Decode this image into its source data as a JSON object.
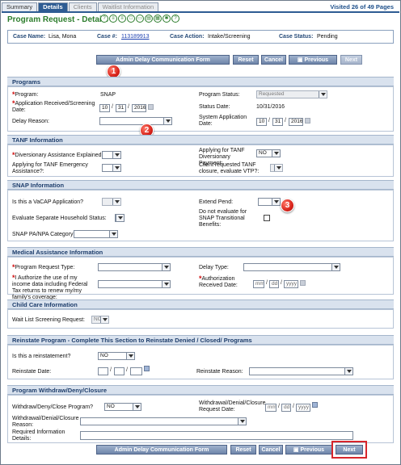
{
  "tabs": [
    {
      "label": "Summary"
    },
    {
      "label": "Details"
    },
    {
      "label": "Clients"
    },
    {
      "label": "Waitlist Information"
    }
  ],
  "visited": "Visited 26 of 49 Pages",
  "page_title": "Program Request - Details",
  "case": {
    "name_label": "Case Name:",
    "name_value": "Lisa, Mona",
    "num_label": "Case #:",
    "num_value": "113189913",
    "action_label": "Case Action:",
    "action_value": "Intake/Screening",
    "status_label": "Case Status:",
    "status_value": "Pending"
  },
  "buttons": {
    "admin_delay": "Admin Delay Communication Form",
    "reset": "Reset",
    "cancel": "Cancel",
    "previous": "Previous",
    "next": "Next"
  },
  "callouts": [
    "1",
    "2",
    "3"
  ],
  "programs": {
    "header": "Programs",
    "program_label": "Program:",
    "program_value": "SNAP",
    "status_label": "Program Status:",
    "status_value": "Requested",
    "app_date_label": "Application Received/Screening Date:",
    "app_month": "10",
    "app_day": "31",
    "app_year": "2016",
    "status_date_label": "Status Date:",
    "status_date_value": "10/31/2016",
    "delay_label": "Delay Reason:",
    "sys_date_label": "System Application Date:",
    "sys_month": "10",
    "sys_day": "31",
    "sys_year": "2016"
  },
  "tanf": {
    "header": "TANF Information",
    "diversionary_label": "Diversionary Assistance Explained:",
    "applying_div_label": "Applying for TANF Diversionary Payment:",
    "applying_div_value": "NO",
    "emergency_label": "Applying for TANF Emergency Assistance?:",
    "vtp_label": "Client requested TANF closure, evaluate VTP?:"
  },
  "snap": {
    "header": "SNAP Information",
    "vacap_label": "Is this a VaCAP Application?",
    "extend_label": "Extend Pend:",
    "separate_label": "Evaluate Separate Household Status:",
    "transitional_label": "Do not evaluate for SNAP Transitional Benefits:",
    "papa_label": "SNAP PA/NPA Category:"
  },
  "medical": {
    "header": "Medical Assistance Information",
    "prt_label": "Program Request Type:",
    "delay_type_label": "Delay Type:",
    "authorize_label": "I Authorize the use of my income data including Federal Tax returns to renew my/my family's coverage:",
    "auth_date_label": "Authorization Received Date:",
    "auth_month": "mm",
    "auth_day": "dd",
    "auth_year": "yyyy"
  },
  "childcare": {
    "header": "Child Care Information",
    "waitlist_label": "Wait List Screening Request:",
    "waitlist_value": "NO"
  },
  "reinstate": {
    "header": "Reinstate Program - Complete This Section to Reinstate Denied / Closed/ Programs",
    "is_reinstatement_label": "Is this a reinstatement?",
    "is_reinstatement_value": "NO",
    "date_label": "Reinstate Date:",
    "reason_label": "Reinstate Reason:"
  },
  "withdraw": {
    "header": "Program Withdraw/Deny/Closure",
    "wdc_label": "Withdraw/Deny/Close Program?",
    "wdc_value": "NO",
    "request_date_label": "Withdrawal/Denial/Closure Request Date:",
    "req_month": "mm",
    "req_day": "dd",
    "req_year": "yyyy",
    "reason_label": "Withdrawal/Denial/Closure Reason:",
    "details_label": "Required Information Details:"
  },
  "colors": {
    "tab_active": "#2e5c93",
    "title": "#2c7d2c",
    "required": "#d01010",
    "section_header": "#d9e2ee",
    "highlight": "#d7262c"
  }
}
